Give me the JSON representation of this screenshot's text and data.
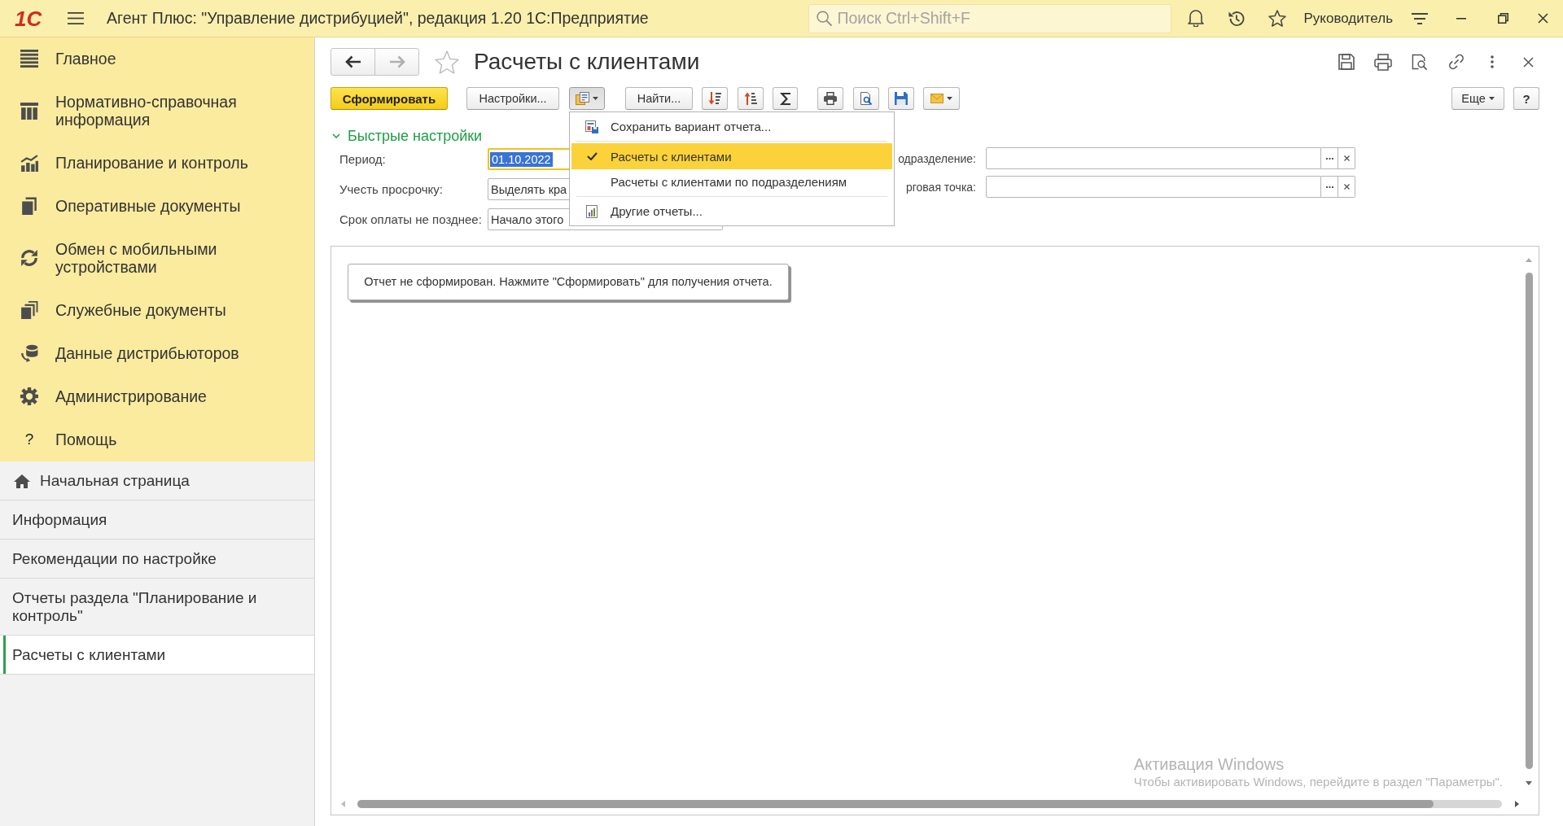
{
  "window": {
    "logo": "1С",
    "title": "Агент Плюс: \"Управление дистрибуцией\", редакция 1.20 1С:Предприятие",
    "search": {
      "placeholder": "Поиск Ctrl+Shift+F"
    },
    "user": "Руководитель"
  },
  "sections": [
    {
      "label": "Главное",
      "selected": false
    },
    {
      "label": "Нормативно-справочная информация",
      "selected": false
    },
    {
      "label": "Планирование и контроль",
      "selected": false
    },
    {
      "label": "Оперативные документы",
      "selected": false
    },
    {
      "label": "Обмен с мобильными устройствами",
      "selected": false
    },
    {
      "label": "Служебные документы",
      "selected": false
    },
    {
      "label": "Данные дистрибьюторов",
      "selected": false
    },
    {
      "label": "Администрирование",
      "selected": false
    },
    {
      "label": "Помощь",
      "glyph": "?",
      "selected": false
    }
  ],
  "open_pages": [
    {
      "kind": "home",
      "label": "Начальная страница",
      "selected": false
    },
    {
      "kind": "page",
      "label": "Информация",
      "selected": false
    },
    {
      "kind": "page",
      "label": "Рекомендации по настройке",
      "selected": false
    },
    {
      "kind": "page",
      "label": "Отчеты раздела \"Планирование и контроль\"",
      "selected": false
    },
    {
      "kind": "page",
      "label": "Расчеты с клиентами",
      "selected": true
    }
  ],
  "form": {
    "navigation": {
      "back": {
        "disabled": false
      },
      "forward": {
        "disabled": true
      }
    },
    "favorite": false,
    "title": "Расчеты с клиентами"
  },
  "toolbar": {
    "generate": "Сформировать",
    "settings": "Настройки...",
    "variants": {
      "expanded": true,
      "items": [
        {
          "kind": "save",
          "label": "Сохранить вариант отчета...",
          "selected": false
        },
        {
          "kind": "variant",
          "label": "Расчеты с клиентами",
          "selected": true
        },
        {
          "kind": "variant",
          "label": "Расчеты с клиентами по подразделениям",
          "selected": false
        },
        {
          "kind": "reports",
          "label": "Другие отчеты...",
          "selected": false
        }
      ]
    },
    "find": "Найти...",
    "more": "Еще",
    "help": "?"
  },
  "quick_settings": {
    "title": "Быстрые настройки",
    "expanded": true,
    "fields": [
      {
        "label": "Период:",
        "value": "01.10.2022",
        "focused": true
      },
      {
        "label": "Учесть просрочку:",
        "value": "Выделять кра",
        "focused": false
      },
      {
        "label": "Срок оплаты не позднее:",
        "value": "Начало этого",
        "focused": false
      }
    ],
    "filters": [
      {
        "label": "одразделение:"
      },
      {
        "label": "рговая точка:"
      }
    ]
  },
  "report": {
    "message": "Отчет не сформирован. Нажмите \"Сформировать\" для получения отчета."
  },
  "os_notice": {
    "title": "Активация Windows",
    "text": "Чтобы активировать Windows, перейдите в раздел \"Параметры\"."
  }
}
